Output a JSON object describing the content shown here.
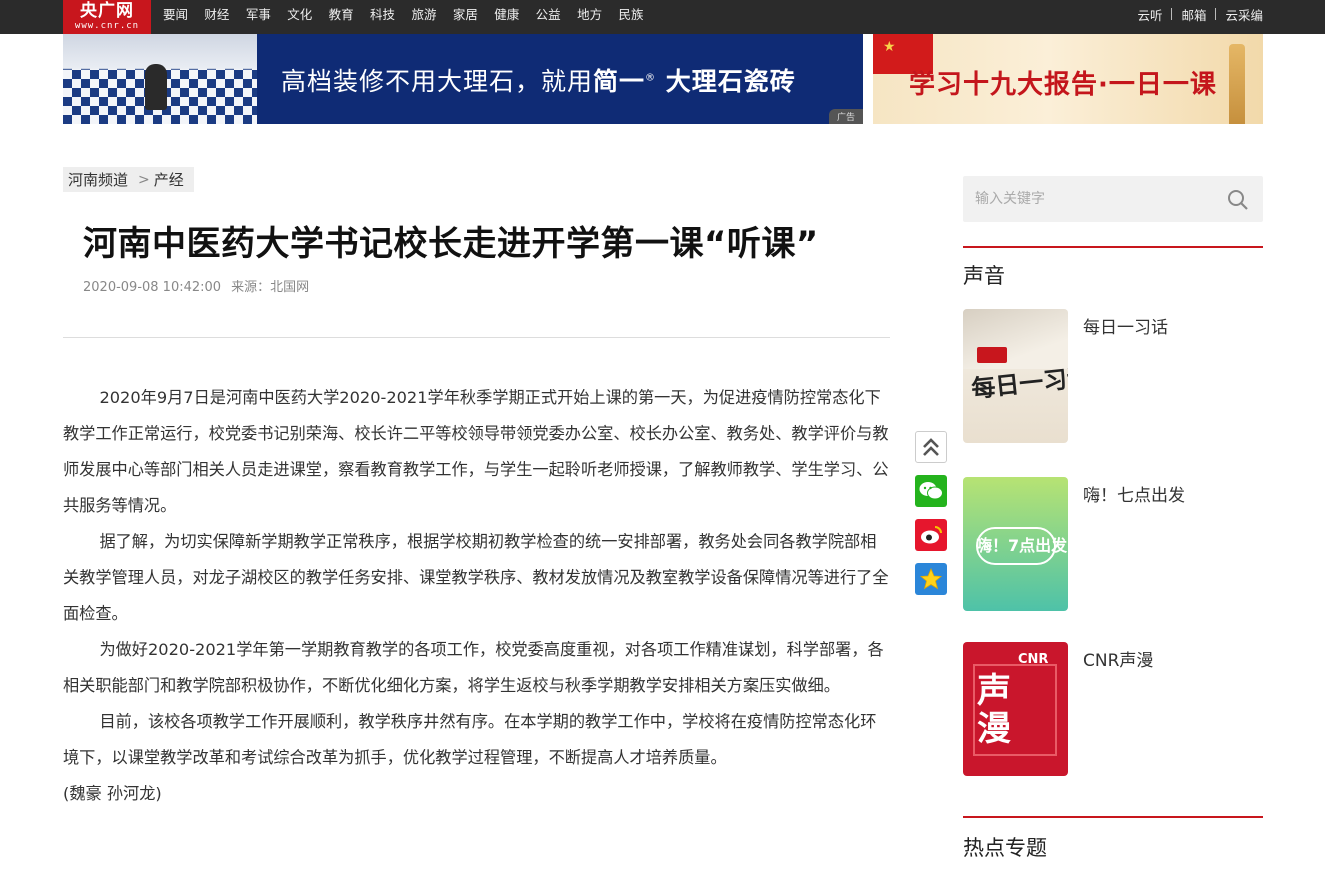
{
  "topbar": {
    "logo_main": "央广网",
    "logo_sub": "www.cnr.cn",
    "nav": [
      "要闻",
      "财经",
      "军事",
      "文化",
      "教育",
      "科技",
      "旅游",
      "家居",
      "健康",
      "公益",
      "地方",
      "民族"
    ],
    "right_links": [
      "云听",
      "邮箱",
      "云采编"
    ]
  },
  "banners": {
    "ad_text_prefix": "高档装修不用大理石，就用",
    "ad_brand": "简一",
    "ad_brand_mark": "®",
    "ad_text_suffix": " 大理石瓷砖",
    "ad_tag": "广告",
    "promo_text": "学习十九大报告·一日一课"
  },
  "breadcrumb": {
    "channel": "河南频道",
    "arrow": ">",
    "section": "产经"
  },
  "article": {
    "title": "河南中医药大学书记校长走进开学第一课“听课”",
    "date": "2020-09-08 10:42:00",
    "source": "来源：北国网",
    "paragraphs": [
      "2020年9月7日是河南中医药大学2020-2021学年秋季学期正式开始上课的第一天，为促进疫情防控常态化下教学工作正常运行，校党委书记别荣海、校长许二平等校领导带领党委办公室、校长办公室、教务处、教学评价与教师发展中心等部门相关人员走进课堂，察看教育教学工作，与学生一起聆听老师授课，了解教师教学、学生学习、公共服务等情况。",
      "据了解，为切实保障新学期教学正常秩序，根据学校期初教学检查的统一安排部署，教务处会同各教学院部相关教学管理人员，对龙子湖校区的教学任务安排、课堂教学秩序、教材发放情况及教室教学设备保障情况等进行了全面检查。",
      "为做好2020-2021学年第一学期教育教学的各项工作，校党委高度重视，对各项工作精准谋划，科学部署，各相关职能部门和教学院部积极协作，不断优化细化方案，将学生返校与秋季学期教学安排相关方案压实做细。",
      "目前，该校各项教学工作开展顺利，教学秩序井然有序。在本学期的教学工作中，学校将在疫情防控常态化环境下，以课堂教学改革和考试综合改革为抓手，优化教学过程管理，不断提高人才培养质量。"
    ],
    "author": "(魏豪 孙河龙)"
  },
  "share": {
    "icons": [
      "back-to-top-icon",
      "wechat-icon",
      "weibo-icon",
      "qzone-icon"
    ]
  },
  "sidebar": {
    "search_placeholder": "输入关键字",
    "voice_title": "声音",
    "voice_items": [
      {
        "label": "每日一习话",
        "thumb_text": "每日一习话"
      },
      {
        "label": "嗨！七点出发",
        "thumb_text": "嗨！7点出发"
      },
      {
        "label": "CNR声漫",
        "thumb_text_top": "CNR",
        "thumb_text_main": "声漫"
      }
    ],
    "hot_title": "热点专题"
  },
  "colors": {
    "brand_red": "#c8161d",
    "topbar_bg": "#2b2b2b",
    "ad_blue": "#0f2b75"
  }
}
